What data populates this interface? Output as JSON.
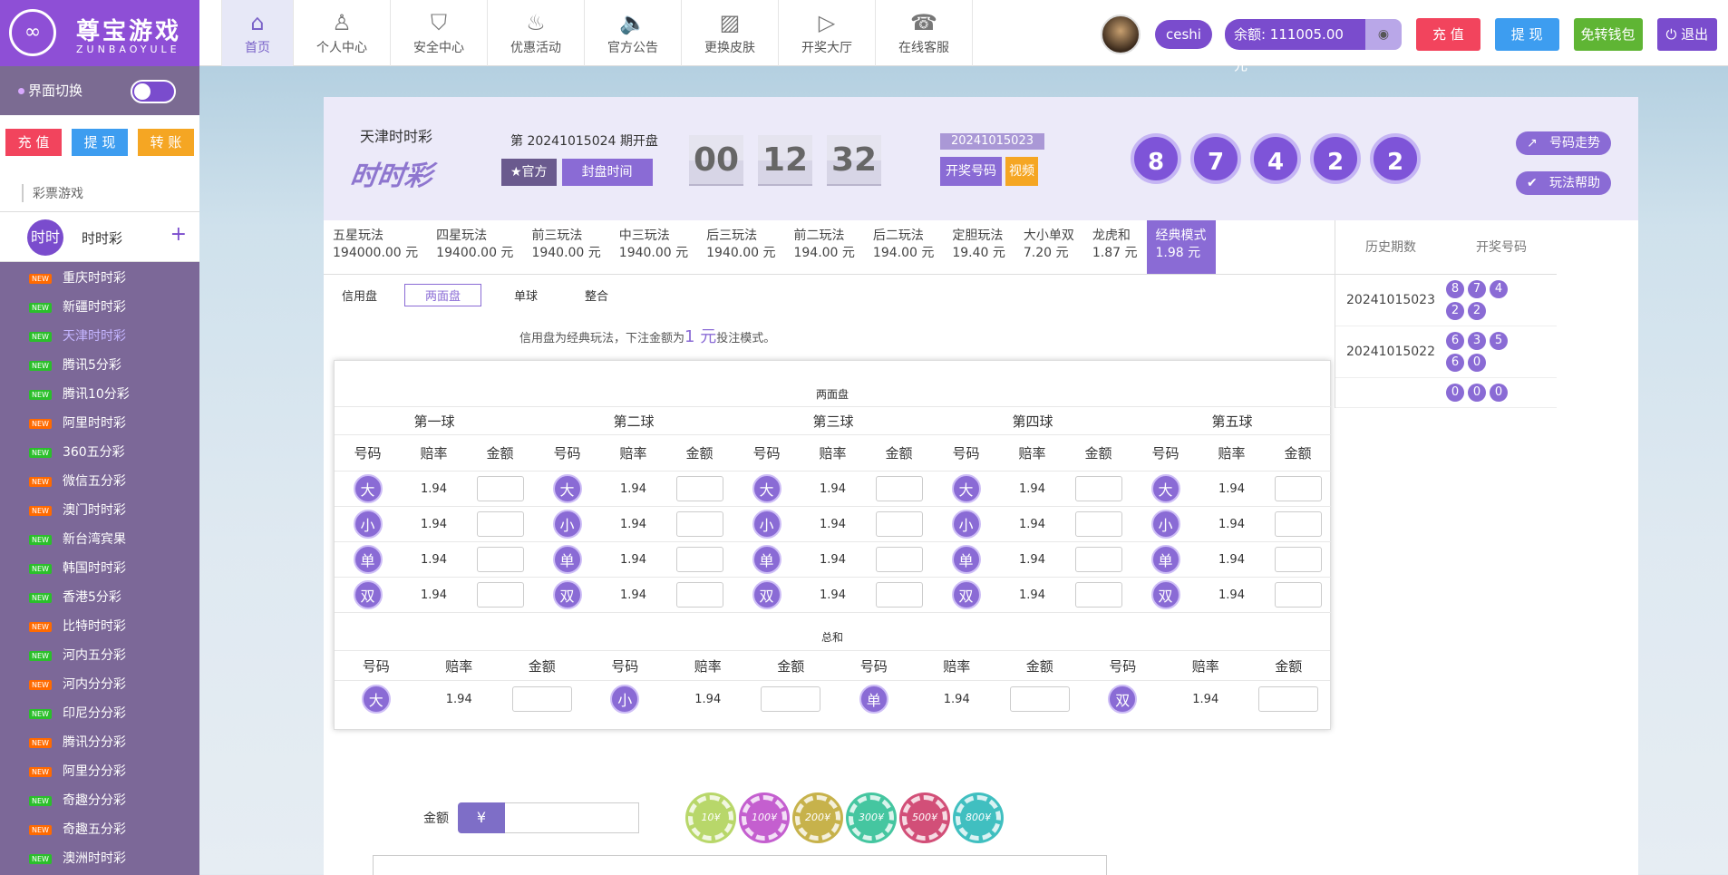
{
  "header": {
    "logo_mark": "∞",
    "logo_cn": "尊宝游戏",
    "logo_en": "ZUNBAOYULE",
    "menu": [
      {
        "icon": "⌂",
        "label": "首页"
      },
      {
        "icon": "♙",
        "label": "个人中心"
      },
      {
        "icon": "⛉",
        "label": "安全中心"
      },
      {
        "icon": "♨",
        "label": "优惠活动"
      },
      {
        "icon": "🔈",
        "label": "官方公告"
      },
      {
        "icon": "▨",
        "label": "更换皮肤"
      },
      {
        "icon": "▷",
        "label": "开奖大厅"
      },
      {
        "icon": "☎",
        "label": "在线客服"
      }
    ],
    "username": "ceshi",
    "balance": "余额: 111005.00元",
    "eye_icon": "◉",
    "recharge": "充 值",
    "withdraw": "提 现",
    "wallet": "免转钱包",
    "logout": "⏻ 退出"
  },
  "sidebar": {
    "switch_label": "界面切换",
    "actions": [
      "充 值",
      "提 现",
      "转 账"
    ],
    "category": "彩票游戏",
    "game_icon": "时时",
    "game_label": "时时彩",
    "plus": "+",
    "badge": "NEW",
    "items": [
      {
        "label": "重庆时时彩",
        "badge_color": "#ff6a00"
      },
      {
        "label": "新疆时时彩",
        "badge_color": "#2bbf2b"
      },
      {
        "label": "天津时时彩",
        "badge_color": "#2bbf2b",
        "active": true
      },
      {
        "label": "腾讯5分彩",
        "badge_color": "#2bbf2b"
      },
      {
        "label": "腾讯10分彩",
        "badge_color": "#2bbf2b"
      },
      {
        "label": "阿里时时彩",
        "badge_color": "#ff6a00"
      },
      {
        "label": "360五分彩",
        "badge_color": "#2bbf2b"
      },
      {
        "label": "微信五分彩",
        "badge_color": "#ff6a00"
      },
      {
        "label": "澳门时时彩",
        "badge_color": "#ff6a00"
      },
      {
        "label": "新台湾宾果",
        "badge_color": "#2bbf2b"
      },
      {
        "label": "韩国时时彩",
        "badge_color": "#2bbf2b"
      },
      {
        "label": "香港5分彩",
        "badge_color": "#2bbf2b"
      },
      {
        "label": "比特时时彩",
        "badge_color": "#ff6a00"
      },
      {
        "label": "河内五分彩",
        "badge_color": "#2bbf2b"
      },
      {
        "label": "河内分分彩",
        "badge_color": "#ff6a00"
      },
      {
        "label": "印尼分分彩",
        "badge_color": "#2bbf2b"
      },
      {
        "label": "腾讯分分彩",
        "badge_color": "#ff6a00"
      },
      {
        "label": "阿里分分彩",
        "badge_color": "#ff6a00"
      },
      {
        "label": "奇趣分分彩",
        "badge_color": "#2bbf2b"
      },
      {
        "label": "奇趣五分彩",
        "badge_color": "#ff6a00"
      },
      {
        "label": "澳洲时时彩",
        "badge_color": "#2bbf2b"
      }
    ]
  },
  "game": {
    "name": "天津时时彩",
    "logo_text": "时时彩",
    "issue_text": "第 20241015024 期开盘",
    "official": "★官方",
    "close_time": "封盘时间",
    "countdown": [
      "00",
      "12",
      "32"
    ],
    "last_issue": "20241015023",
    "kjh_label": "开奖号码",
    "video_label": "视频",
    "balls": [
      "8",
      "7",
      "4",
      "2",
      "2"
    ],
    "trend": "号码走势",
    "help": "玩法帮助"
  },
  "tabs": [
    {
      "name": "五星玩法",
      "odds": "194000.00 元"
    },
    {
      "name": "四星玩法",
      "odds": "19400.00 元"
    },
    {
      "name": "前三玩法",
      "odds": "1940.00 元"
    },
    {
      "name": "中三玩法",
      "odds": "1940.00 元"
    },
    {
      "name": "后三玩法",
      "odds": "1940.00 元"
    },
    {
      "name": "前二玩法",
      "odds": "194.00 元"
    },
    {
      "name": "后二玩法",
      "odds": "194.00 元"
    },
    {
      "name": "定胆玩法",
      "odds": "19.40 元"
    },
    {
      "name": "大小单双",
      "odds": "7.20 元"
    },
    {
      "name": "龙虎和",
      "odds": "1.87 元"
    },
    {
      "name": "经典模式",
      "odds": "1.98 元",
      "active": true
    }
  ],
  "history": {
    "col1": "历史期数",
    "col2": "开奖号码",
    "rows": [
      {
        "issue": "20241015023",
        "nums": [
          "8",
          "7",
          "4",
          "2",
          "2"
        ]
      },
      {
        "issue": "20241015022",
        "nums": [
          "6",
          "3",
          "5",
          "6",
          "0"
        ]
      },
      {
        "issue": "",
        "nums": [
          "0",
          "0",
          "0"
        ]
      }
    ]
  },
  "subtabs": [
    "信用盘",
    "两面盘",
    "单球",
    "整合"
  ],
  "note_pre": "信用盘为经典玩法，下注金额为",
  "note_num": "1 元",
  "note_post": "投注模式。",
  "board": {
    "title": "两面盘",
    "groups": [
      "第一球",
      "第二球",
      "第三球",
      "第四球",
      "第五球"
    ],
    "cols": [
      "号码",
      "赔率",
      "金额"
    ],
    "options": [
      "大",
      "小",
      "单",
      "双"
    ],
    "odds": "1.94",
    "sum_title": "总和"
  },
  "amount": {
    "label": "金额",
    "currency": "¥"
  },
  "chips": [
    {
      "label": "10¥",
      "color": "#b8d76a"
    },
    {
      "label": "100¥",
      "color": "#c45fcf"
    },
    {
      "label": "200¥",
      "color": "#c7b24b"
    },
    {
      "label": "300¥",
      "color": "#45c6a0"
    },
    {
      "label": "500¥",
      "color": "#d24f78"
    },
    {
      "label": "800¥",
      "color": "#40bfc0"
    }
  ]
}
